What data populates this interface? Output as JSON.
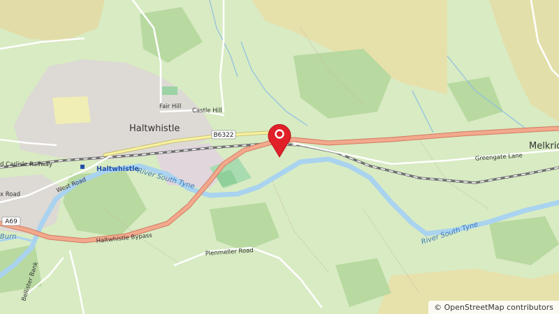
{
  "map": {
    "towns": {
      "haltwhistle": "Haltwhistle",
      "melkridge": "Melkrid"
    },
    "places": {
      "fair_hill": "Fair Hill",
      "castle_hill": "Castle Hill"
    },
    "roads": {
      "b6322": "B6322",
      "a69": "A69",
      "west_road": "West Road",
      "bypass": "Haltwhistle Bypass",
      "greengate_lane": "Greengate Lane",
      "plenmeller_road": "Plenmeller Road",
      "bellister_bank": "Bellister Bank",
      "railway": "d Carlisle Railway",
      "x_road": "x Road"
    },
    "water": {
      "river_south_tyne_1": "River South Tyne",
      "river_south_tyne_2": "River South Tyne",
      "burn": "Burn"
    },
    "station": "Haltwhistle",
    "marker": {
      "icon": "map-pin-icon",
      "color": "#e0212a"
    }
  },
  "attribution": "© OpenStreetMap contributors"
}
